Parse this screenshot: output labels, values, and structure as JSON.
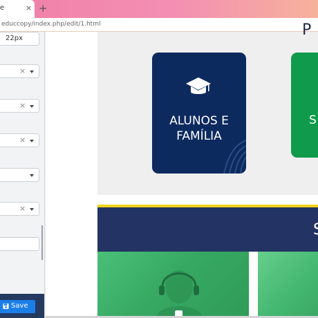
{
  "browser": {
    "tab_title": "e",
    "tab_close": "×",
    "new_tab": "+",
    "url": "educcopy/index.php/edit/1.html"
  },
  "sidebar": {
    "fields": [
      {
        "value": "22px",
        "has_clear": false,
        "has_caret": false
      },
      {
        "value": "",
        "has_clear": true,
        "has_caret": true
      },
      {
        "value": "",
        "has_clear": true,
        "has_caret": true
      },
      {
        "value": "",
        "has_clear": true,
        "has_caret": true
      },
      {
        "value": "",
        "has_clear": false,
        "has_caret": true
      },
      {
        "value": "",
        "has_clear": true,
        "has_caret": true
      },
      {
        "value": "",
        "has_clear": false,
        "has_caret": false
      }
    ],
    "clear_glyph": "×",
    "save_label": "Save"
  },
  "canvas": {
    "section_title_partial": "P",
    "cards": [
      {
        "label_line1": "ALUNOS E",
        "label_line2": "FAMÍLIA",
        "color": "#0d2a5f",
        "icon": "graduation-cap-icon"
      },
      {
        "label_partial": "S",
        "color": "#0f9b4b"
      }
    ],
    "band_letter": "S",
    "colors": {
      "accent_yellow": "#f1d11a",
      "navy": "#233464",
      "save_blue": "#1b7ee8"
    }
  }
}
